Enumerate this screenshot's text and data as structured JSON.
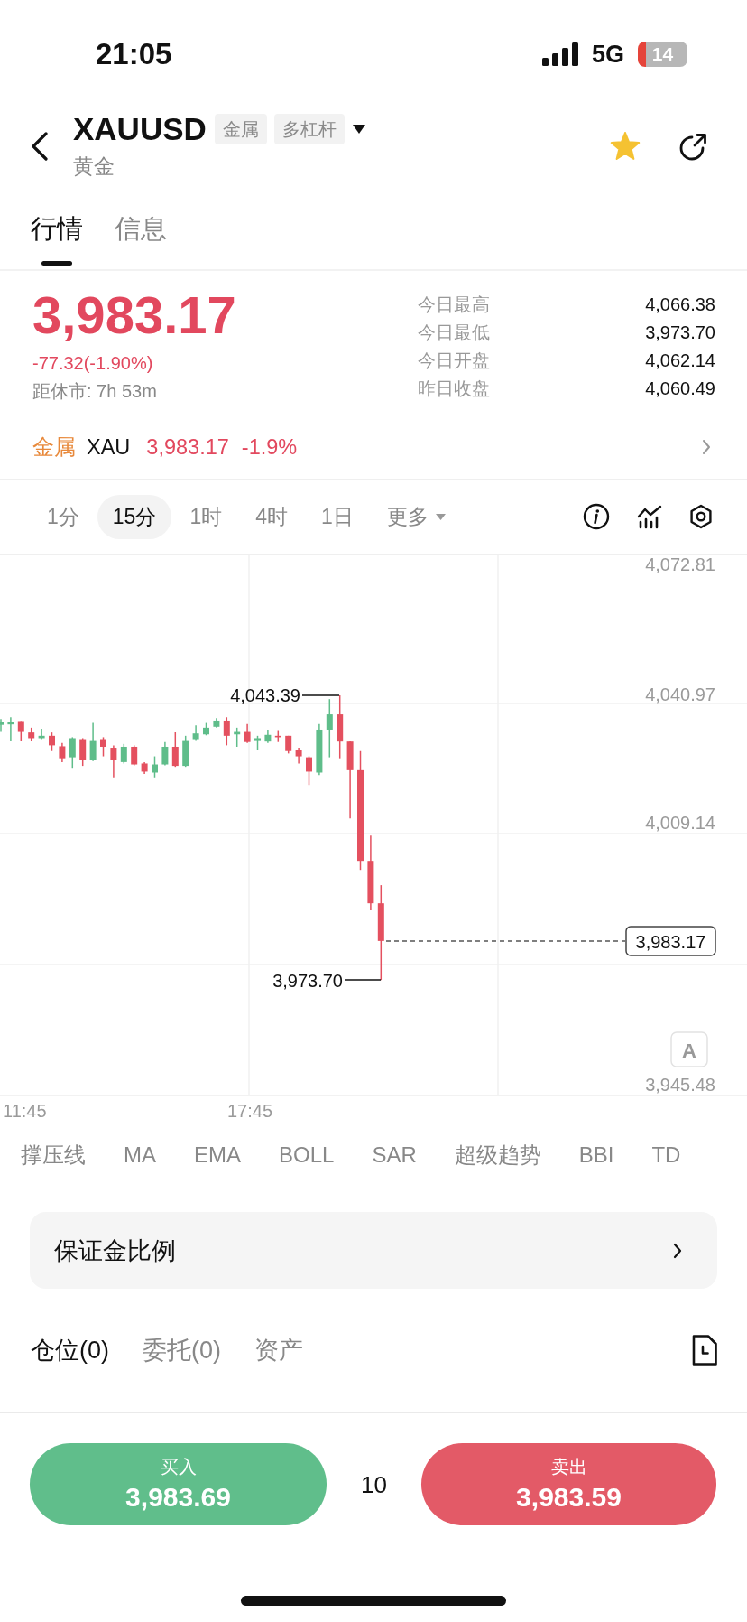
{
  "status_bar": {
    "time": "21:05",
    "network": "5G",
    "battery": "14"
  },
  "header": {
    "symbol": "XAUUSD",
    "tags": [
      "金属",
      "多杠杆"
    ],
    "name": "黄金",
    "favorite": true
  },
  "tabs": [
    {
      "label": "行情",
      "selected": true
    },
    {
      "label": "信息",
      "selected": false
    }
  ],
  "quote": {
    "price": "3,983.17",
    "change": "-77.32(-1.90%)",
    "market_close": "距休市: 7h 53m",
    "stats": [
      {
        "label": "今日最高",
        "value": "4,066.38"
      },
      {
        "label": "今日最低",
        "value": "3,973.70"
      },
      {
        "label": "今日开盘",
        "value": "4,062.14"
      },
      {
        "label": "昨日收盘",
        "value": "4,060.49"
      }
    ]
  },
  "related": {
    "category": "金属",
    "symbol": "XAU",
    "price": "3,983.17",
    "change": "-1.9%"
  },
  "timeframes": [
    {
      "label": "1分",
      "selected": false
    },
    {
      "label": "15分",
      "selected": true
    },
    {
      "label": "1时",
      "selected": false
    },
    {
      "label": "4时",
      "selected": false
    },
    {
      "label": "1日",
      "selected": false
    }
  ],
  "more_menu": "更多",
  "chart": {
    "price_axis_labels": [
      "4,072.81",
      "4,040.97",
      "4,009.14",
      "3,945.48"
    ],
    "time_axis_labels": [
      "11:45",
      "17:45"
    ],
    "high_price": "4,043.39",
    "low_price": "3,973.70",
    "last_price": "3,983.17",
    "scale_button": "A"
  },
  "indicators": [
    "撑压线",
    "MA",
    "EMA",
    "BOLL",
    "SAR",
    "超级趋势",
    "BBI",
    "TD"
  ],
  "margin_ratio": "保证金比例",
  "position_tabs": [
    {
      "label": "仓位(0)",
      "selected": true
    },
    {
      "label": "委托(0)",
      "selected": false
    },
    {
      "label": "资产",
      "selected": false
    }
  ],
  "trade": {
    "buy": {
      "label": "买入",
      "price": "3,983.69"
    },
    "quantity": "10",
    "sell": {
      "label": "卖出",
      "price": "3,983.59"
    }
  }
}
